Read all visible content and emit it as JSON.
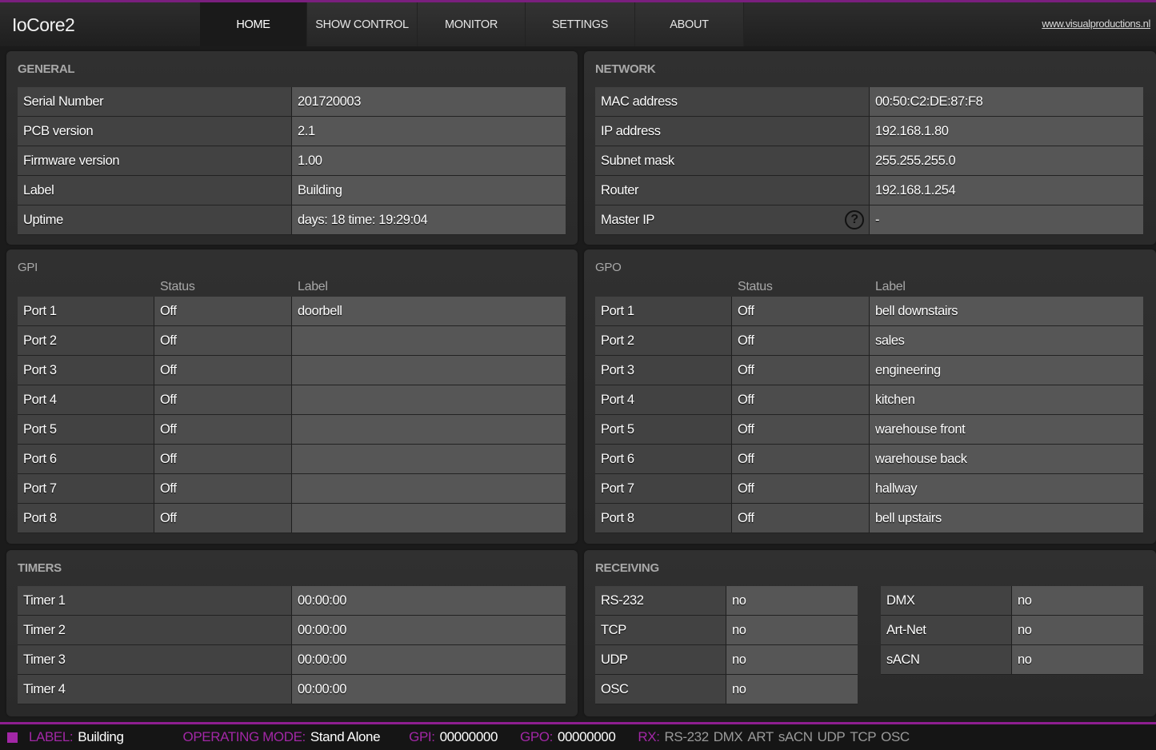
{
  "app": {
    "title": "IoCore2",
    "site_link": "www.visualproductions.nl"
  },
  "nav": {
    "tabs": [
      {
        "label": "HOME",
        "active": true
      },
      {
        "label": "SHOW CONTROL",
        "active": false
      },
      {
        "label": "MONITOR",
        "active": false
      },
      {
        "label": "SETTINGS",
        "active": false
      },
      {
        "label": "ABOUT",
        "active": false
      }
    ]
  },
  "general": {
    "title": "GENERAL",
    "rows": [
      {
        "key": "Serial Number",
        "value": "201720003"
      },
      {
        "key": "PCB version",
        "value": "2.1"
      },
      {
        "key": "Firmware version",
        "value": "1.00"
      },
      {
        "key": "Label",
        "value": "Building"
      },
      {
        "key": "Uptime",
        "value": "days: 18 time: 19:29:04"
      }
    ]
  },
  "network": {
    "title": "NETWORK",
    "rows": [
      {
        "key": "MAC address",
        "value": "00:50:C2:DE:87:F8"
      },
      {
        "key": "IP address",
        "value": "192.168.1.80"
      },
      {
        "key": "Subnet mask",
        "value": "255.255.255.0"
      },
      {
        "key": "Router",
        "value": "192.168.1.254"
      },
      {
        "key": "Master IP",
        "value": "-",
        "help_icon": "question-circle-icon"
      }
    ],
    "help_glyph": "?"
  },
  "gpi": {
    "title": "GPI",
    "col_status": "Status",
    "col_label": "Label",
    "rows": [
      {
        "port": "Port 1",
        "status": "Off",
        "label": "doorbell"
      },
      {
        "port": "Port 2",
        "status": "Off",
        "label": ""
      },
      {
        "port": "Port 3",
        "status": "Off",
        "label": ""
      },
      {
        "port": "Port 4",
        "status": "Off",
        "label": ""
      },
      {
        "port": "Port 5",
        "status": "Off",
        "label": ""
      },
      {
        "port": "Port 6",
        "status": "Off",
        "label": ""
      },
      {
        "port": "Port 7",
        "status": "Off",
        "label": ""
      },
      {
        "port": "Port 8",
        "status": "Off",
        "label": ""
      }
    ]
  },
  "gpo": {
    "title": "GPO",
    "col_status": "Status",
    "col_label": "Label",
    "rows": [
      {
        "port": "Port 1",
        "status": "Off",
        "label": "bell downstairs"
      },
      {
        "port": "Port 2",
        "status": "Off",
        "label": "sales"
      },
      {
        "port": "Port 3",
        "status": "Off",
        "label": "engineering"
      },
      {
        "port": "Port 4",
        "status": "Off",
        "label": "kitchen"
      },
      {
        "port": "Port 5",
        "status": "Off",
        "label": "warehouse front"
      },
      {
        "port": "Port 6",
        "status": "Off",
        "label": "warehouse back"
      },
      {
        "port": "Port 7",
        "status": "Off",
        "label": "hallway"
      },
      {
        "port": "Port 8",
        "status": "Off",
        "label": "bell upstairs"
      }
    ]
  },
  "timers": {
    "title": "TIMERS",
    "rows": [
      {
        "key": "Timer 1",
        "value": "00:00:00"
      },
      {
        "key": "Timer 2",
        "value": "00:00:00"
      },
      {
        "key": "Timer 3",
        "value": "00:00:00"
      },
      {
        "key": "Timer 4",
        "value": "00:00:00"
      }
    ]
  },
  "receiving": {
    "title": "RECEIVING",
    "left": [
      {
        "key": "RS-232",
        "value": "no"
      },
      {
        "key": "TCP",
        "value": "no"
      },
      {
        "key": "UDP",
        "value": "no"
      },
      {
        "key": "OSC",
        "value": "no"
      }
    ],
    "right": [
      {
        "key": "DMX",
        "value": "no"
      },
      {
        "key": "Art-Net",
        "value": "no"
      },
      {
        "key": "sACN",
        "value": "no"
      }
    ]
  },
  "statusbar": {
    "label_key": "LABEL:",
    "label_value": "Building",
    "mode_key": "OPERATING MODE:",
    "mode_value": "Stand Alone",
    "gpi_key": "GPI:",
    "gpi_value": "00000000",
    "gpo_key": "GPO:",
    "gpo_value": "00000000",
    "rx_key": "RX:",
    "rx_items": [
      "RS-232",
      "DMX",
      "ART",
      "sACN",
      "UDP",
      "TCP",
      "OSC"
    ],
    "accent_color": "#a227a6"
  }
}
